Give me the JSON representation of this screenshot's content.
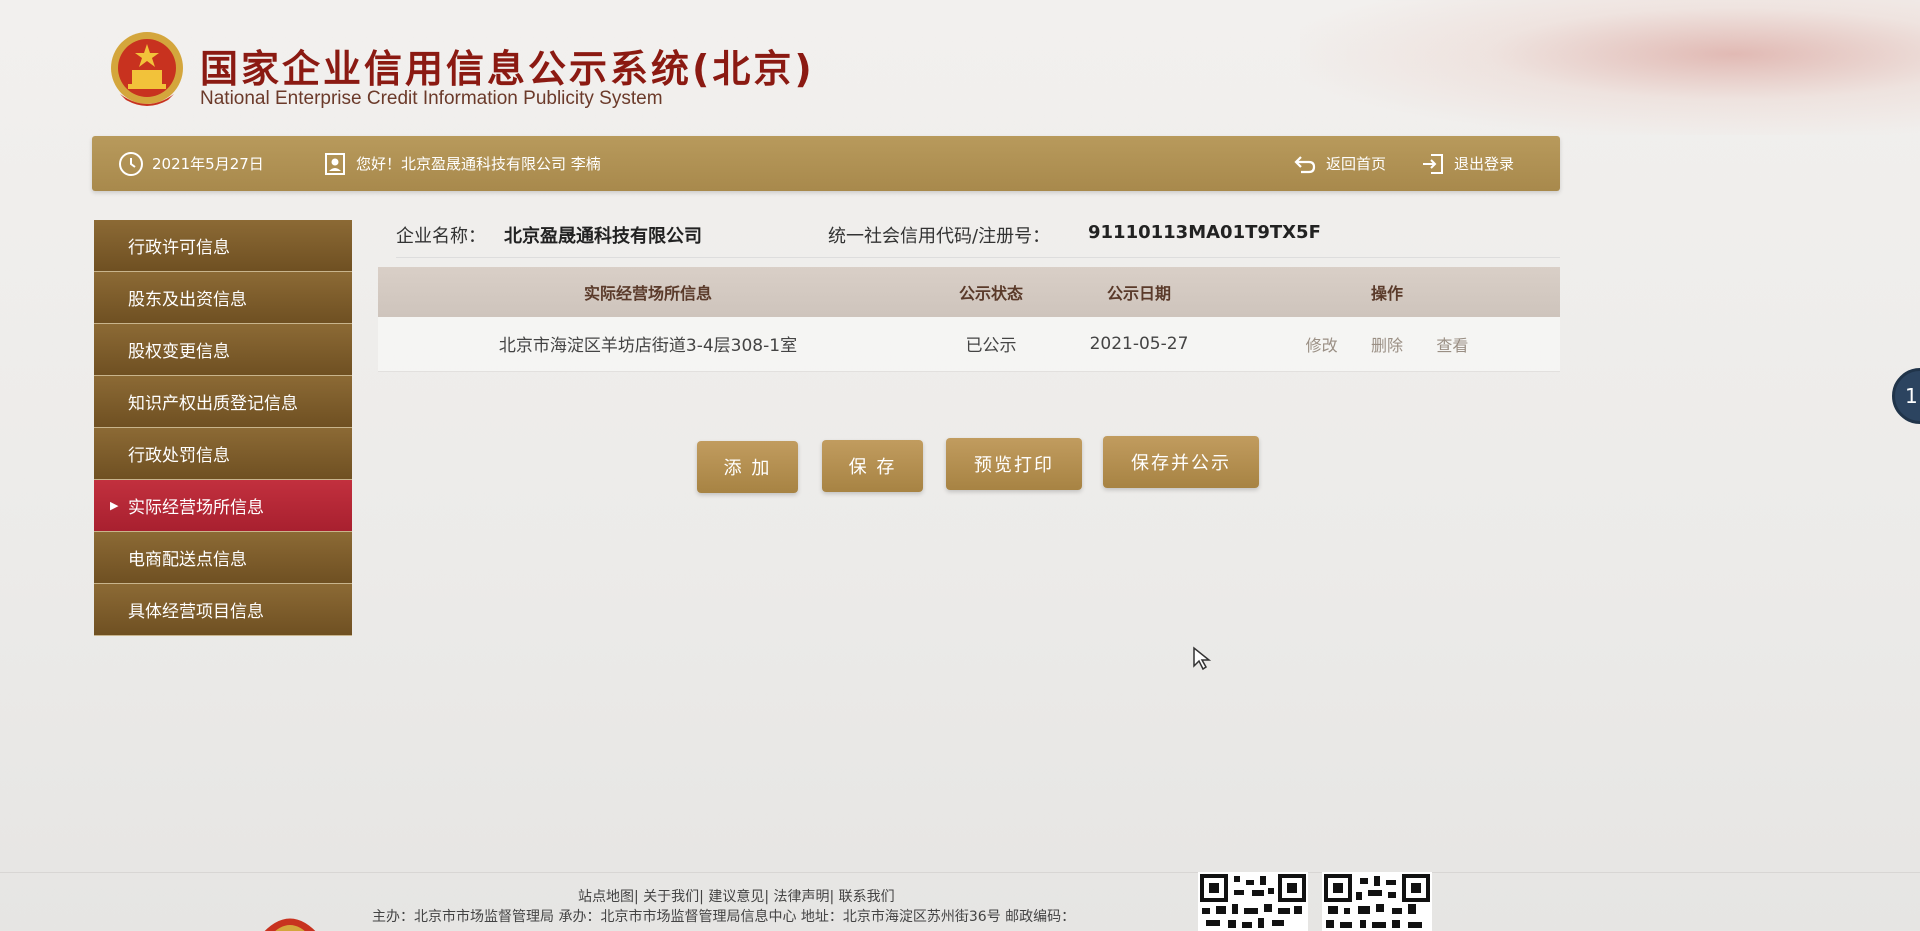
{
  "header": {
    "title_cn": "国家企业信用信息公示系统(北京)",
    "title_en": "National Enterprise Credit Information Publicity System",
    "emblem_icon": "national-emblem-icon"
  },
  "topbar": {
    "date": "2021年5月27日",
    "greeting": "您好！北京盈晟通科技有限公司  李楠",
    "home_label": "返回首页",
    "logout_label": "退出登录"
  },
  "sidebar": {
    "items": [
      {
        "label": "行政许可信息",
        "active": false
      },
      {
        "label": "股东及出资信息",
        "active": false
      },
      {
        "label": "股权变更信息",
        "active": false
      },
      {
        "label": "知识产权出质登记信息",
        "active": false
      },
      {
        "label": "行政处罚信息",
        "active": false
      },
      {
        "label": "实际经营场所信息",
        "active": true
      },
      {
        "label": "电商配送点信息",
        "active": false
      },
      {
        "label": "具体经营项目信息",
        "active": false
      }
    ]
  },
  "company": {
    "name_label": "企业名称：",
    "name_value": "北京盈晟通科技有限公司",
    "code_label": "统一社会信用代码/注册号：",
    "code_value": "91110113MA01T9TX5F"
  },
  "table": {
    "headers": [
      "实际经营场所信息",
      "公示状态",
      "公示日期",
      "操作"
    ],
    "rows": [
      {
        "address": "北京市海淀区羊坊店街道3-4层308-1室",
        "status": "已公示",
        "date": "2021-05-27",
        "ops": [
          "修改",
          "删除",
          "查看"
        ]
      }
    ]
  },
  "buttons": {
    "add": "添 加",
    "save": "保 存",
    "preview_print": "预览打印",
    "save_publish": "保存并公示"
  },
  "edge_badge": "1",
  "footer": {
    "links": "站点地图| 关于我们| 建议意见| 法律声明| 联系我们",
    "info": "主办：北京市市场监督管理局  承办：北京市市场监督管理局信息中心  地址：北京市海淀区苏州街36号  邮政编码："
  },
  "colors": {
    "brand_gold": "#a8894c",
    "sidebar_brown": "#7a5a2a",
    "active_red": "#b52636",
    "title_red": "#8b1a12"
  }
}
